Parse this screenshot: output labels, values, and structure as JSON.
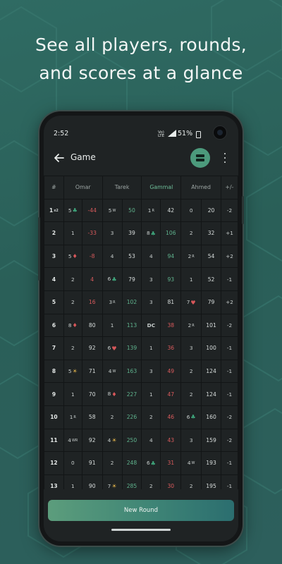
{
  "headline": {
    "line1": "See all players, rounds,",
    "line2": "and scores at a glance"
  },
  "status": {
    "time": "2:52",
    "network": "Vo)\nLTE",
    "battery": "51%"
  },
  "appbar": {
    "title": "Game"
  },
  "table": {
    "headers": [
      "#",
      "Omar",
      "Tarek",
      "Gammal",
      "Ahmed",
      "+/-"
    ],
    "rows": [
      {
        "n": "1",
        "sub": "x2",
        "c": [
          [
            "5",
            "♣",
            ""
          ],
          [
            "-44",
            "neg"
          ],
          [
            "5",
            "",
            "W"
          ],
          [
            "50",
            "pos"
          ],
          [
            "1",
            "",
            "R"
          ],
          [
            "42",
            "tot"
          ],
          [
            "0",
            ""
          ],
          [
            "20",
            "tot"
          ]
        ],
        "d": "-2"
      },
      {
        "n": "2",
        "c": [
          [
            "1",
            ""
          ],
          [
            "-33",
            "neg"
          ],
          [
            "3",
            ""
          ],
          [
            "39",
            "tot"
          ],
          [
            "8",
            "♣",
            ""
          ],
          [
            "106",
            "pos"
          ],
          [
            "2",
            ""
          ],
          [
            "32",
            "tot"
          ]
        ],
        "d": "+1"
      },
      {
        "n": "3",
        "c": [
          [
            "5",
            "♦",
            ""
          ],
          [
            "-8",
            "neg"
          ],
          [
            "4",
            ""
          ],
          [
            "53",
            "tot"
          ],
          [
            "4",
            ""
          ],
          [
            "94",
            "pos"
          ],
          [
            "2",
            "",
            "R"
          ],
          [
            "54",
            "tot"
          ]
        ],
        "d": "+2"
      },
      {
        "n": "4",
        "c": [
          [
            "2",
            ""
          ],
          [
            "4",
            "neg"
          ],
          [
            "6",
            "♣",
            ""
          ],
          [
            "79",
            "tot"
          ],
          [
            "3",
            ""
          ],
          [
            "93",
            "pos"
          ],
          [
            "1",
            ""
          ],
          [
            "52",
            "tot"
          ]
        ],
        "d": "-1"
      },
      {
        "n": "5",
        "c": [
          [
            "2",
            ""
          ],
          [
            "16",
            "neg"
          ],
          [
            "3",
            "",
            "R"
          ],
          [
            "102",
            "pos"
          ],
          [
            "3",
            ""
          ],
          [
            "81",
            "tot"
          ],
          [
            "7",
            "♥",
            ""
          ],
          [
            "79",
            "tot"
          ]
        ],
        "d": "+2"
      },
      {
        "n": "6",
        "c": [
          [
            "8",
            "♦",
            ""
          ],
          [
            "80",
            "tot"
          ],
          [
            "1",
            ""
          ],
          [
            "113",
            "pos"
          ],
          [
            "DC",
            "dc"
          ],
          [
            "38",
            "neg"
          ],
          [
            "2",
            "",
            "R"
          ],
          [
            "101",
            "tot"
          ]
        ],
        "d": "-2"
      },
      {
        "n": "7",
        "c": [
          [
            "2",
            ""
          ],
          [
            "92",
            "tot"
          ],
          [
            "6",
            "♥",
            ""
          ],
          [
            "139",
            "pos"
          ],
          [
            "1",
            ""
          ],
          [
            "36",
            "neg"
          ],
          [
            "3",
            ""
          ],
          [
            "100",
            "tot"
          ]
        ],
        "d": "-1"
      },
      {
        "n": "8",
        "c": [
          [
            "5",
            "☀",
            ""
          ],
          [
            "71",
            "tot"
          ],
          [
            "4",
            "",
            "W"
          ],
          [
            "163",
            "pos"
          ],
          [
            "3",
            ""
          ],
          [
            "49",
            "neg"
          ],
          [
            "2",
            ""
          ],
          [
            "124",
            "tot"
          ]
        ],
        "d": "-1"
      },
      {
        "n": "9",
        "c": [
          [
            "1",
            ""
          ],
          [
            "70",
            "tot"
          ],
          [
            "8",
            "♦",
            ""
          ],
          [
            "227",
            "pos"
          ],
          [
            "1",
            ""
          ],
          [
            "47",
            "neg"
          ],
          [
            "2",
            ""
          ],
          [
            "124",
            "tot"
          ]
        ],
        "d": "-1"
      },
      {
        "n": "10",
        "c": [
          [
            "1",
            "",
            "R"
          ],
          [
            "58",
            "tot"
          ],
          [
            "2",
            ""
          ],
          [
            "226",
            "pos"
          ],
          [
            "2",
            ""
          ],
          [
            "46",
            "neg"
          ],
          [
            "6",
            "♣",
            ""
          ],
          [
            "160",
            "tot"
          ]
        ],
        "d": "-2"
      },
      {
        "n": "11",
        "c": [
          [
            "4",
            "",
            "WR"
          ],
          [
            "92",
            "tot"
          ],
          [
            "4",
            "☀",
            ""
          ],
          [
            "250",
            "pos"
          ],
          [
            "4",
            ""
          ],
          [
            "43",
            "neg"
          ],
          [
            "3",
            ""
          ],
          [
            "159",
            "tot"
          ]
        ],
        "d": "-2"
      },
      {
        "n": "12",
        "c": [
          [
            "0",
            ""
          ],
          [
            "91",
            "tot"
          ],
          [
            "2",
            ""
          ],
          [
            "248",
            "pos"
          ],
          [
            "6",
            "♣",
            ""
          ],
          [
            "31",
            "neg"
          ],
          [
            "4",
            "",
            "W"
          ],
          [
            "193",
            "tot"
          ]
        ],
        "d": "-1"
      },
      {
        "n": "13",
        "c": [
          [
            "1",
            ""
          ],
          [
            "90",
            "tot"
          ],
          [
            "7",
            "☀",
            ""
          ],
          [
            "285",
            "pos"
          ],
          [
            "2",
            ""
          ],
          [
            "30",
            "neg"
          ],
          [
            "2",
            ""
          ],
          [
            "195",
            "tot"
          ]
        ],
        "d": "-1"
      }
    ]
  },
  "button": {
    "new_round": "New Round"
  },
  "colors": {
    "accent": "#4c9a7c",
    "negative": "#d95a5c",
    "positive": "#5fb38d",
    "background": "#2f6b63"
  },
  "icons": {
    "back": "arrow-left-icon",
    "fab": "scoreboard-icon",
    "menu": "more-vert-icon",
    "camera": "camera-icon"
  }
}
